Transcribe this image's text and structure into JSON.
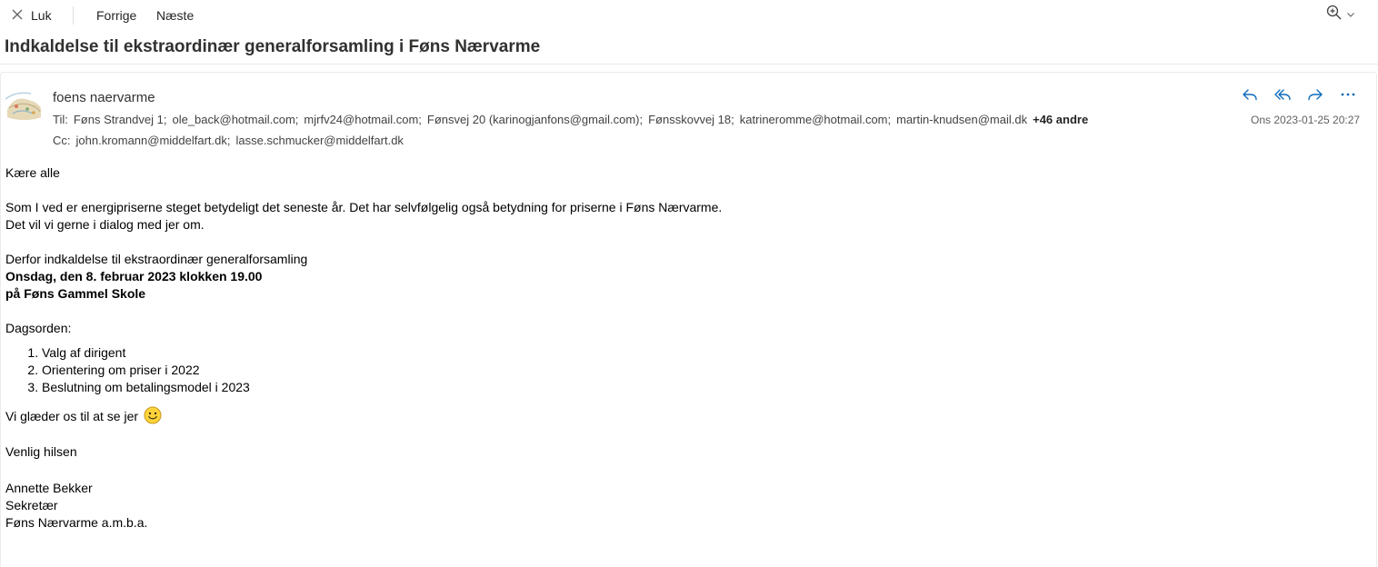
{
  "toolbar": {
    "close_label": "Luk",
    "prev_label": "Forrige",
    "next_label": "Næste",
    "icons": {
      "close": "close-icon",
      "zoom": "zoom-in-icon",
      "chevron": "chevron-down-icon"
    }
  },
  "message": {
    "subject": "Indkaldelse til ekstraordinær generalforsamling i Føns Nærvarme",
    "sender": "foens naervarme",
    "to_label": "Til:",
    "cc_label": "Cc:",
    "to": [
      "Føns Strandvej 1;",
      "ole_back@hotmail.com;",
      "mjrfv24@hotmail.com;",
      "Fønsvej 20 (karinogjanfons@gmail.com);",
      "Fønsskovvej 18;",
      "katrineromme@hotmail.com;",
      "martin-knudsen@mail.dk"
    ],
    "to_more": "+46 andre",
    "cc": [
      "john.kromann@middelfart.dk;",
      "lasse.schmucker@middelfart.dk"
    ],
    "date": "Ons 2023-01-25 20:27",
    "accent_color": "#0f6cbd",
    "icons": {
      "reply": "reply-icon",
      "reply_all": "reply-all-icon",
      "forward": "forward-icon",
      "more": "more-icon"
    }
  },
  "body": {
    "greeting": "Kære alle",
    "para1_line1": "Som I ved er energipriserne steget betydeligt det seneste år. Det har selvfølgelig også betydning for priserne i Føns Nærvarme.",
    "para1_line2": "Det vil vi gerne i dialog med jer om.",
    "invite_line": "Derfor indkaldelse til ekstraordinær generalforsamling",
    "invite_date": "Onsdag, den 8. februar 2023 klokken 19.00",
    "invite_place": "på Føns Gammel Skole",
    "agenda_title": "Dagsorden:",
    "agenda": [
      "Valg af dirigent",
      "Orientering om priser i 2022",
      "Beslutning om betalingsmodel i 2023"
    ],
    "closing_text": "Vi glæder os til at se jer",
    "regards": "Venlig hilsen",
    "sig_name": "Annette Bekker",
    "sig_title": "Sekretær",
    "sig_org": "Føns Nærvarme a.m.b.a."
  }
}
